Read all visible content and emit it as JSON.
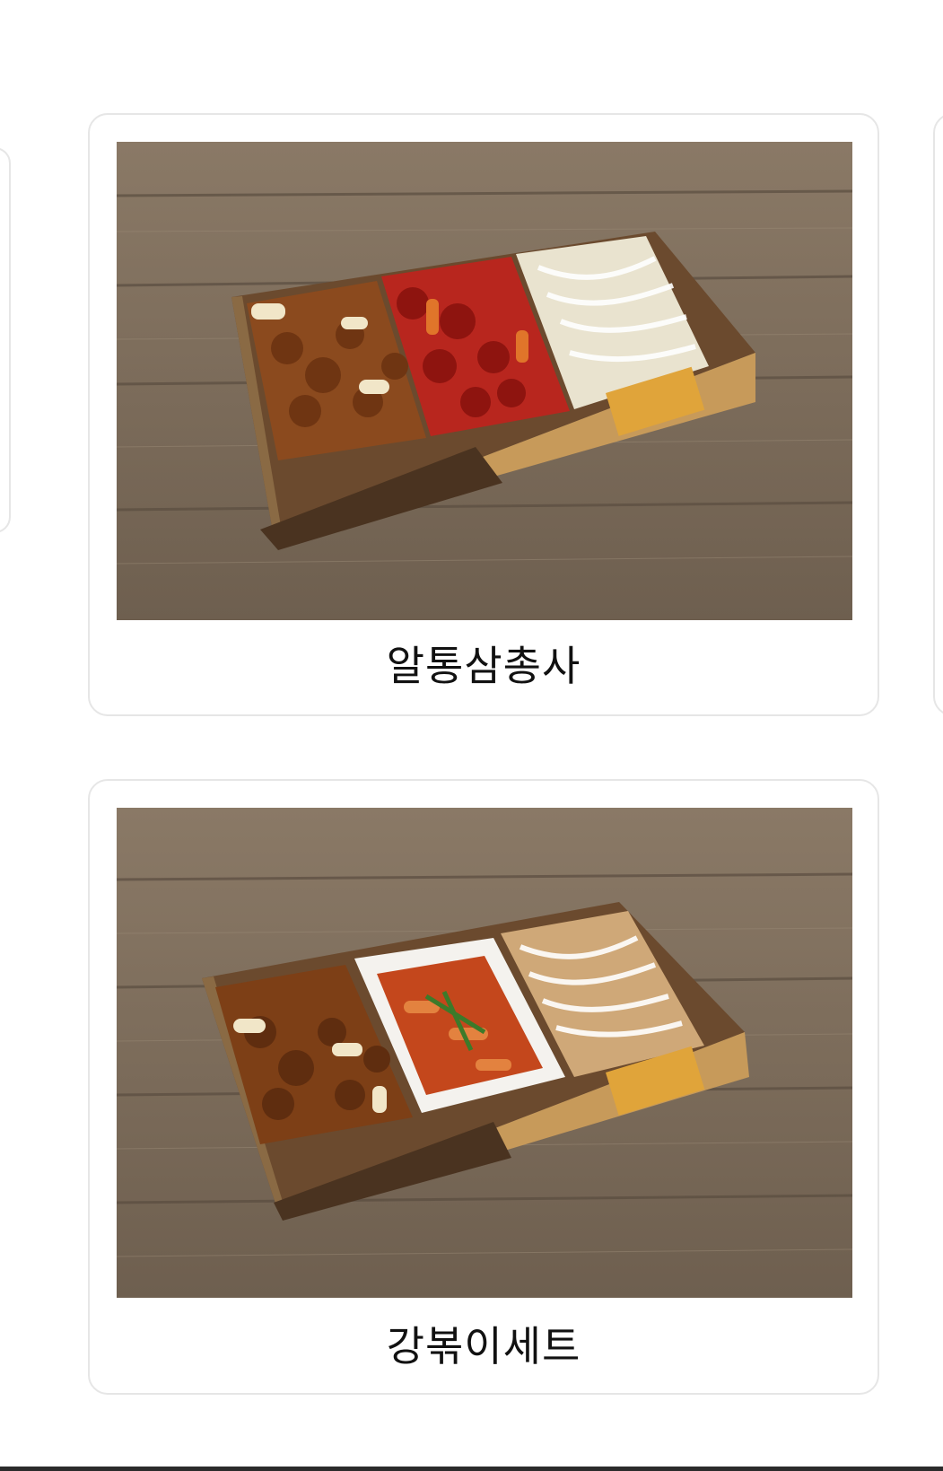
{
  "menu": {
    "items": [
      {
        "name": "알통삼총사"
      },
      {
        "name": "강볶이세트"
      }
    ]
  },
  "colors": {
    "card_border": "#e6e6e6",
    "background": "#ffffff",
    "wood": "#7a6a58"
  }
}
